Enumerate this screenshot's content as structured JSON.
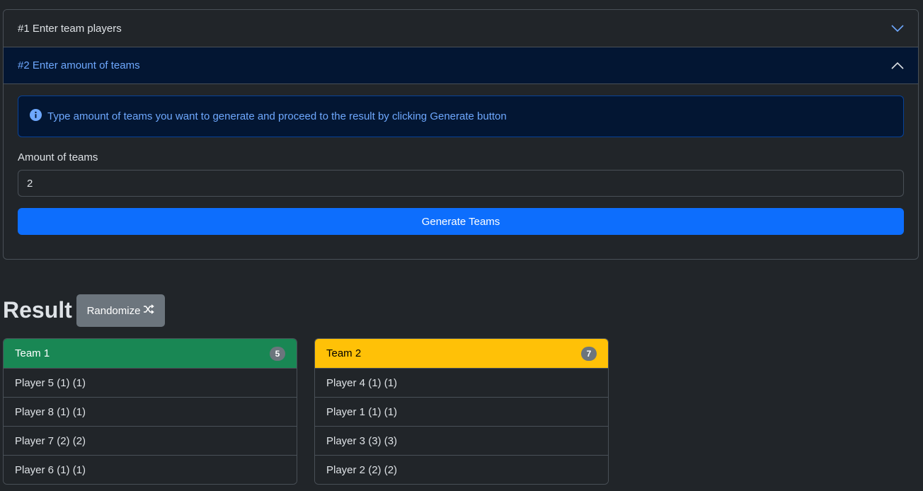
{
  "accordion": {
    "step1_label": "#1 Enter team players",
    "step2_label": "#2 Enter amount of teams",
    "info_text": "Type amount of teams you want to generate and proceed to the result by clicking Generate button",
    "amount_label": "Amount of teams",
    "amount_value": "2",
    "generate_label": "Generate Teams"
  },
  "result": {
    "title": "Result",
    "randomize_label": "Randomize"
  },
  "teams": [
    {
      "name": "Team 1",
      "count": "5",
      "color": "#198754",
      "text_color": "#ffffff",
      "players": [
        "Player 5 (1) (1)",
        "Player 8 (1) (1)",
        "Player 7 (2) (2)",
        "Player 6 (1) (1)"
      ]
    },
    {
      "name": "Team 2",
      "count": "7",
      "color": "#ffc107",
      "text_color": "#000000",
      "players": [
        "Player 4 (1) (1)",
        "Player 1 (1) (1)",
        "Player 3 (3) (3)",
        "Player 2 (2) (2)"
      ]
    }
  ],
  "colors": {
    "primary": "#0d6efd",
    "info_bg": "#031633",
    "info_text": "#6ea8fe"
  }
}
